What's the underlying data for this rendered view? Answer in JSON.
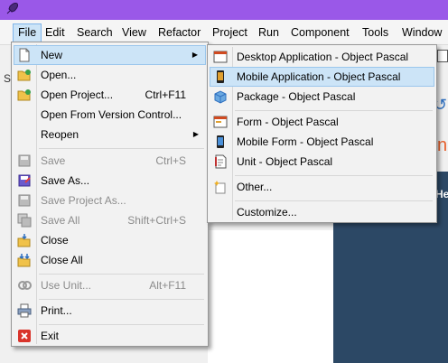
{
  "colors": {
    "titlebar": "#9a58e8",
    "highlight": "#cce4f7",
    "exit_icon": "#d9342b",
    "dark_panel": "#2c4865"
  },
  "menubar": [
    {
      "label": "File"
    },
    {
      "label": "Edit"
    },
    {
      "label": "Search"
    },
    {
      "label": "View"
    },
    {
      "label": "Refactor"
    },
    {
      "label": "Project"
    },
    {
      "label": "Run"
    },
    {
      "label": "Component"
    },
    {
      "label": "Tools"
    },
    {
      "label": "Window"
    }
  ],
  "background": {
    "left_char": "S",
    "right_char": "ne",
    "panel_label": "He"
  },
  "file_menu": {
    "new": {
      "label": "New",
      "icon": "new-file-icon"
    },
    "open": {
      "label": "Open...",
      "icon": "open-folder-icon"
    },
    "open_project": {
      "label": "Open Project...",
      "shortcut": "Ctrl+F11",
      "icon": "open-project-icon"
    },
    "open_vc": {
      "label": "Open From Version Control..."
    },
    "reopen": {
      "label": "Reopen"
    },
    "save": {
      "label": "Save",
      "shortcut": "Ctrl+S",
      "icon": "save-icon"
    },
    "save_as": {
      "label": "Save As...",
      "icon": "save-as-icon"
    },
    "save_project_as": {
      "label": "Save Project As...",
      "icon": "save-project-icon"
    },
    "save_all": {
      "label": "Save All",
      "shortcut": "Shift+Ctrl+S",
      "icon": "save-all-icon"
    },
    "close": {
      "label": "Close",
      "icon": "close-file-icon"
    },
    "close_all": {
      "label": "Close All",
      "icon": "close-all-icon"
    },
    "use_unit": {
      "label": "Use Unit...",
      "shortcut": "Alt+F11",
      "icon": "use-unit-icon"
    },
    "print": {
      "label": "Print...",
      "icon": "printer-icon"
    },
    "exit": {
      "label": "Exit",
      "icon": "exit-icon"
    }
  },
  "new_submenu": {
    "desktop": {
      "label": "Desktop Application - Object Pascal",
      "icon": "desktop-app-icon"
    },
    "mobile": {
      "label": "Mobile Application - Object Pascal",
      "icon": "mobile-app-icon"
    },
    "package": {
      "label": "Package - Object Pascal",
      "icon": "package-icon"
    },
    "form": {
      "label": "Form - Object Pascal",
      "icon": "form-icon"
    },
    "mobile_form": {
      "label": "Mobile Form - Object Pascal",
      "icon": "mobile-form-icon"
    },
    "unit": {
      "label": "Unit - Object Pascal",
      "icon": "unit-icon"
    },
    "other": {
      "label": "Other...",
      "icon": "other-wizard-icon"
    },
    "customize": {
      "label": "Customize..."
    }
  }
}
